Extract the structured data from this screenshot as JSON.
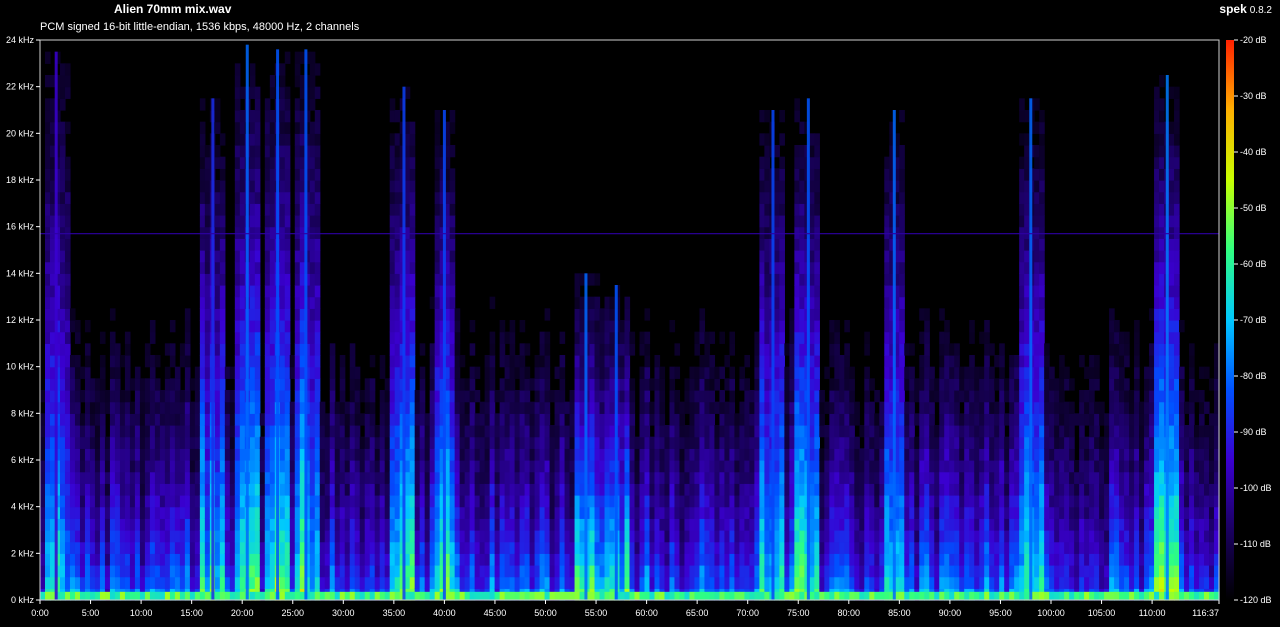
{
  "header": {
    "title": "Alien 70mm mix.wav",
    "subtitle": "PCM signed 16-bit little-endian, 1536 kbps, 48000 Hz, 2 channels",
    "app_name": "spek",
    "app_version": "0.8.2"
  },
  "chart_data": {
    "type": "heatmap",
    "title": "Alien 70mm mix.wav",
    "subtitle": "PCM signed 16-bit little-endian, 1536 kbps, 48000 Hz, 2 channels",
    "x_axis": {
      "unit": "minutes",
      "range": [
        0,
        116.617
      ],
      "tick_labels": [
        "0:00",
        "5:00",
        "10:00",
        "15:00",
        "20:00",
        "25:00",
        "30:00",
        "35:00",
        "40:00",
        "45:00",
        "50:00",
        "55:00",
        "60:00",
        "65:00",
        "70:00",
        "75:00",
        "80:00",
        "85:00",
        "90:00",
        "95:00",
        "100:00",
        "105:00",
        "110:00",
        "116:37"
      ],
      "tick_values": [
        0,
        5,
        10,
        15,
        20,
        25,
        30,
        35,
        40,
        45,
        50,
        55,
        60,
        65,
        70,
        75,
        80,
        85,
        90,
        95,
        100,
        105,
        110,
        116.617
      ]
    },
    "y_axis": {
      "unit": "kHz",
      "range": [
        0,
        24
      ],
      "tick_labels": [
        "0 kHz",
        "2 kHz",
        "4 kHz",
        "6 kHz",
        "8 kHz",
        "10 kHz",
        "12 kHz",
        "14 kHz",
        "16 kHz",
        "18 kHz",
        "20 kHz",
        "22 kHz",
        "24 kHz"
      ],
      "tick_values": [
        0,
        2,
        4,
        6,
        8,
        10,
        12,
        14,
        16,
        18,
        20,
        22,
        24
      ]
    },
    "color_scale": {
      "unit": "dB",
      "range": [
        -120,
        -20
      ],
      "tick_labels": [
        "-20 dB",
        "-30 dB",
        "-40 dB",
        "-50 dB",
        "-60 dB",
        "-70 dB",
        "-80 dB",
        "-90 dB",
        "-100 dB",
        "-110 dB",
        "-120 dB"
      ],
      "tick_values": [
        -20,
        -30,
        -40,
        -50,
        -60,
        -70,
        -80,
        -90,
        -100,
        -110,
        -120
      ],
      "colors": [
        "#000000",
        "#1a0060",
        "#3a00d0",
        "#0050ff",
        "#00c8ff",
        "#30ff80",
        "#c8ff00",
        "#ffb000",
        "#ff2000"
      ]
    },
    "features": {
      "constant_tone_khz": 15.7,
      "bursts": [
        {
          "t": 1.6,
          "top_khz": 23.5,
          "level": -95
        },
        {
          "t": 17.1,
          "top_khz": 21.5,
          "level": -88
        },
        {
          "t": 20.5,
          "top_khz": 23.8,
          "level": -80
        },
        {
          "t": 23.5,
          "top_khz": 23.6,
          "level": -82
        },
        {
          "t": 26.3,
          "top_khz": 23.6,
          "level": -82
        },
        {
          "t": 36.0,
          "top_khz": 22.0,
          "level": -85
        },
        {
          "t": 40.0,
          "top_khz": 21.0,
          "level": -84
        },
        {
          "t": 54.0,
          "top_khz": 14.0,
          "level": -80
        },
        {
          "t": 57.0,
          "top_khz": 13.5,
          "level": -82
        },
        {
          "t": 72.5,
          "top_khz": 21.0,
          "level": -84
        },
        {
          "t": 76.0,
          "top_khz": 21.5,
          "level": -82
        },
        {
          "t": 84.5,
          "top_khz": 21.0,
          "level": -80
        },
        {
          "t": 98.0,
          "top_khz": 21.5,
          "level": -80
        },
        {
          "t": 111.5,
          "top_khz": 22.5,
          "level": -78
        }
      ]
    }
  }
}
